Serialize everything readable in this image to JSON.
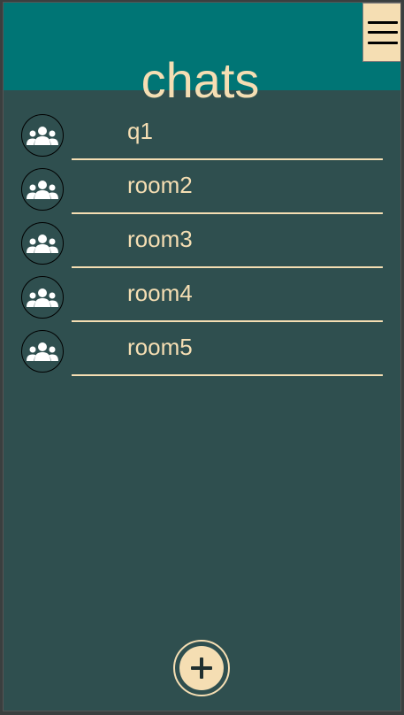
{
  "header": {
    "title": "chats",
    "menu_icon": "hamburger-menu-icon"
  },
  "chats": [
    {
      "name": "q1",
      "icon": "group-icon"
    },
    {
      "name": "room2",
      "icon": "group-icon"
    },
    {
      "name": "room3",
      "icon": "group-icon"
    },
    {
      "name": "room4",
      "icon": "group-icon"
    },
    {
      "name": "room5",
      "icon": "group-icon"
    }
  ],
  "fab": {
    "icon": "plus-icon"
  },
  "colors": {
    "header_bg": "#007575",
    "body_bg": "#2f4f4f",
    "accent": "#f5deb3"
  }
}
